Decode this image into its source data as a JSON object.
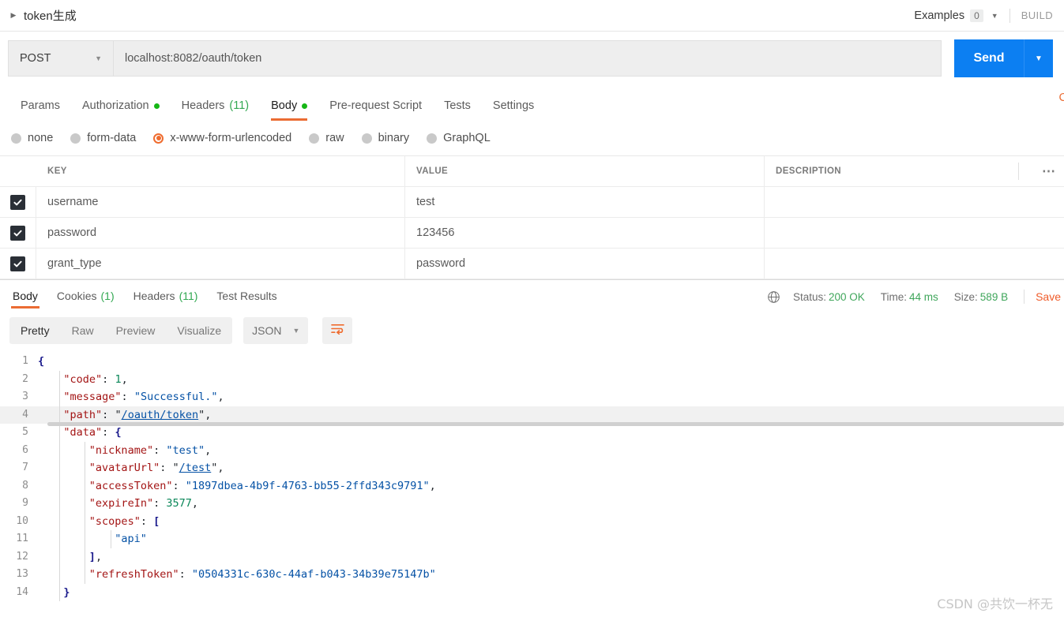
{
  "titlebar": {
    "caret_icon": "triangle-right-icon",
    "title": "token生成",
    "examples_label": "Examples",
    "examples_count": "0",
    "examples_caret_icon": "chevron-down-icon",
    "build_label": "BUILD"
  },
  "request": {
    "method": "POST",
    "method_caret_icon": "chevron-down-icon",
    "url": "localhost:8082/oauth/token",
    "send_label": "Send",
    "send_caret_icon": "chevron-down-icon"
  },
  "request_tabs": [
    {
      "label": "Params",
      "badge": "",
      "dot": false,
      "active": false
    },
    {
      "label": "Authorization",
      "badge": "",
      "dot": true,
      "active": false
    },
    {
      "label": "Headers",
      "badge": "(11)",
      "dot": false,
      "active": false
    },
    {
      "label": "Body",
      "badge": "",
      "dot": true,
      "active": true
    },
    {
      "label": "Pre-request Script",
      "badge": "",
      "dot": false,
      "active": false
    },
    {
      "label": "Tests",
      "badge": "",
      "dot": false,
      "active": false
    },
    {
      "label": "Settings",
      "badge": "",
      "dot": false,
      "active": false
    }
  ],
  "cookies_edge_label": "C",
  "body_types": [
    {
      "label": "none",
      "selected": false
    },
    {
      "label": "form-data",
      "selected": false
    },
    {
      "label": "x-www-form-urlencoded",
      "selected": true
    },
    {
      "label": "raw",
      "selected": false
    },
    {
      "label": "binary",
      "selected": false
    },
    {
      "label": "GraphQL",
      "selected": false
    }
  ],
  "kv_table": {
    "headers": {
      "key": "KEY",
      "value": "VALUE",
      "description": "DESCRIPTION"
    },
    "more_icon": "ellipsis-icon",
    "rows": [
      {
        "checked": true,
        "key": "username",
        "value": "test",
        "description": ""
      },
      {
        "checked": true,
        "key": "password",
        "value": "123456",
        "description": ""
      },
      {
        "checked": true,
        "key": "grant_type",
        "value": "password",
        "description": ""
      }
    ]
  },
  "response_tabs": [
    {
      "label": "Body",
      "badge": "",
      "active": true
    },
    {
      "label": "Cookies",
      "badge": "(1)",
      "active": false
    },
    {
      "label": "Headers",
      "badge": "(11)",
      "active": false
    },
    {
      "label": "Test Results",
      "badge": "",
      "active": false
    }
  ],
  "response_meta": {
    "globe_icon": "globe-icon",
    "status_label": "Status:",
    "status_value": "200 OK",
    "time_label": "Time:",
    "time_value": "44 ms",
    "size_label": "Size:",
    "size_value": "589 B",
    "save_label": "Save"
  },
  "response_toolbar": {
    "views": [
      {
        "label": "Pretty",
        "active": true
      },
      {
        "label": "Raw",
        "active": false
      },
      {
        "label": "Preview",
        "active": false
      },
      {
        "label": "Visualize",
        "active": false
      }
    ],
    "format": "JSON",
    "format_caret_icon": "chevron-down-icon",
    "wrap_icon": "word-wrap-icon"
  },
  "response_body": {
    "language": "json",
    "highlighted_line": 4,
    "lines": [
      {
        "n": "1",
        "indent": 0,
        "tokens": [
          {
            "t": "brace",
            "v": "{"
          }
        ]
      },
      {
        "n": "2",
        "indent": 1,
        "tokens": [
          {
            "t": "key",
            "v": "\"code\""
          },
          {
            "t": "pun",
            "v": ": "
          },
          {
            "t": "num",
            "v": "1"
          },
          {
            "t": "pun",
            "v": ","
          }
        ]
      },
      {
        "n": "3",
        "indent": 1,
        "tokens": [
          {
            "t": "key",
            "v": "\"message\""
          },
          {
            "t": "pun",
            "v": ": "
          },
          {
            "t": "str",
            "v": "\"Successful.\""
          },
          {
            "t": "pun",
            "v": ","
          }
        ]
      },
      {
        "n": "4",
        "indent": 1,
        "tokens": [
          {
            "t": "key",
            "v": "\"path\""
          },
          {
            "t": "pun",
            "v": ": "
          },
          {
            "t": "pun",
            "v": "\""
          },
          {
            "t": "link",
            "v": "/oauth/token"
          },
          {
            "t": "pun",
            "v": "\""
          },
          {
            "t": "pun",
            "v": ","
          }
        ]
      },
      {
        "n": "5",
        "indent": 1,
        "tokens": [
          {
            "t": "key",
            "v": "\"data\""
          },
          {
            "t": "pun",
            "v": ": "
          },
          {
            "t": "brace",
            "v": "{"
          }
        ]
      },
      {
        "n": "6",
        "indent": 2,
        "tokens": [
          {
            "t": "key",
            "v": "\"nickname\""
          },
          {
            "t": "pun",
            "v": ": "
          },
          {
            "t": "str",
            "v": "\"test\""
          },
          {
            "t": "pun",
            "v": ","
          }
        ]
      },
      {
        "n": "7",
        "indent": 2,
        "tokens": [
          {
            "t": "key",
            "v": "\"avatarUrl\""
          },
          {
            "t": "pun",
            "v": ": "
          },
          {
            "t": "pun",
            "v": "\""
          },
          {
            "t": "link",
            "v": "/test"
          },
          {
            "t": "pun",
            "v": "\""
          },
          {
            "t": "pun",
            "v": ","
          }
        ]
      },
      {
        "n": "8",
        "indent": 2,
        "tokens": [
          {
            "t": "key",
            "v": "\"accessToken\""
          },
          {
            "t": "pun",
            "v": ": "
          },
          {
            "t": "str",
            "v": "\"1897dbea-4b9f-4763-bb55-2ffd343c9791\""
          },
          {
            "t": "pun",
            "v": ","
          }
        ]
      },
      {
        "n": "9",
        "indent": 2,
        "tokens": [
          {
            "t": "key",
            "v": "\"expireIn\""
          },
          {
            "t": "pun",
            "v": ": "
          },
          {
            "t": "num",
            "v": "3577"
          },
          {
            "t": "pun",
            "v": ","
          }
        ]
      },
      {
        "n": "10",
        "indent": 2,
        "tokens": [
          {
            "t": "key",
            "v": "\"scopes\""
          },
          {
            "t": "pun",
            "v": ": "
          },
          {
            "t": "brace",
            "v": "["
          }
        ]
      },
      {
        "n": "11",
        "indent": 3,
        "tokens": [
          {
            "t": "str",
            "v": "\"api\""
          }
        ]
      },
      {
        "n": "12",
        "indent": 2,
        "tokens": [
          {
            "t": "brace",
            "v": "]"
          },
          {
            "t": "pun",
            "v": ","
          }
        ]
      },
      {
        "n": "13",
        "indent": 2,
        "tokens": [
          {
            "t": "key",
            "v": "\"refreshToken\""
          },
          {
            "t": "pun",
            "v": ": "
          },
          {
            "t": "str",
            "v": "\"0504331c-630c-44af-b043-34b39e75147b\""
          }
        ]
      },
      {
        "n": "14",
        "indent": 1,
        "tokens": [
          {
            "t": "brace",
            "v": "}"
          }
        ]
      }
    ],
    "data": {
      "code": 1,
      "message": "Successful.",
      "path": "/oauth/token",
      "data": {
        "nickname": "test",
        "avatarUrl": "/test",
        "accessToken": "1897dbea-4b9f-4763-bb55-2ffd343c9791",
        "expireIn": 3577,
        "scopes": [
          "api"
        ],
        "refreshToken": "0504331c-630c-44af-b043-34b39e75147b"
      }
    }
  },
  "watermark": "CSDN @共饮一杯无",
  "colors": {
    "accent_orange": "#eb6c33",
    "send_blue": "#0c7ff2",
    "status_green": "#3fa65b",
    "dot_green": "#15b615",
    "json_key": "#a31515",
    "json_string": "#0451a5",
    "json_number": "#098658"
  }
}
